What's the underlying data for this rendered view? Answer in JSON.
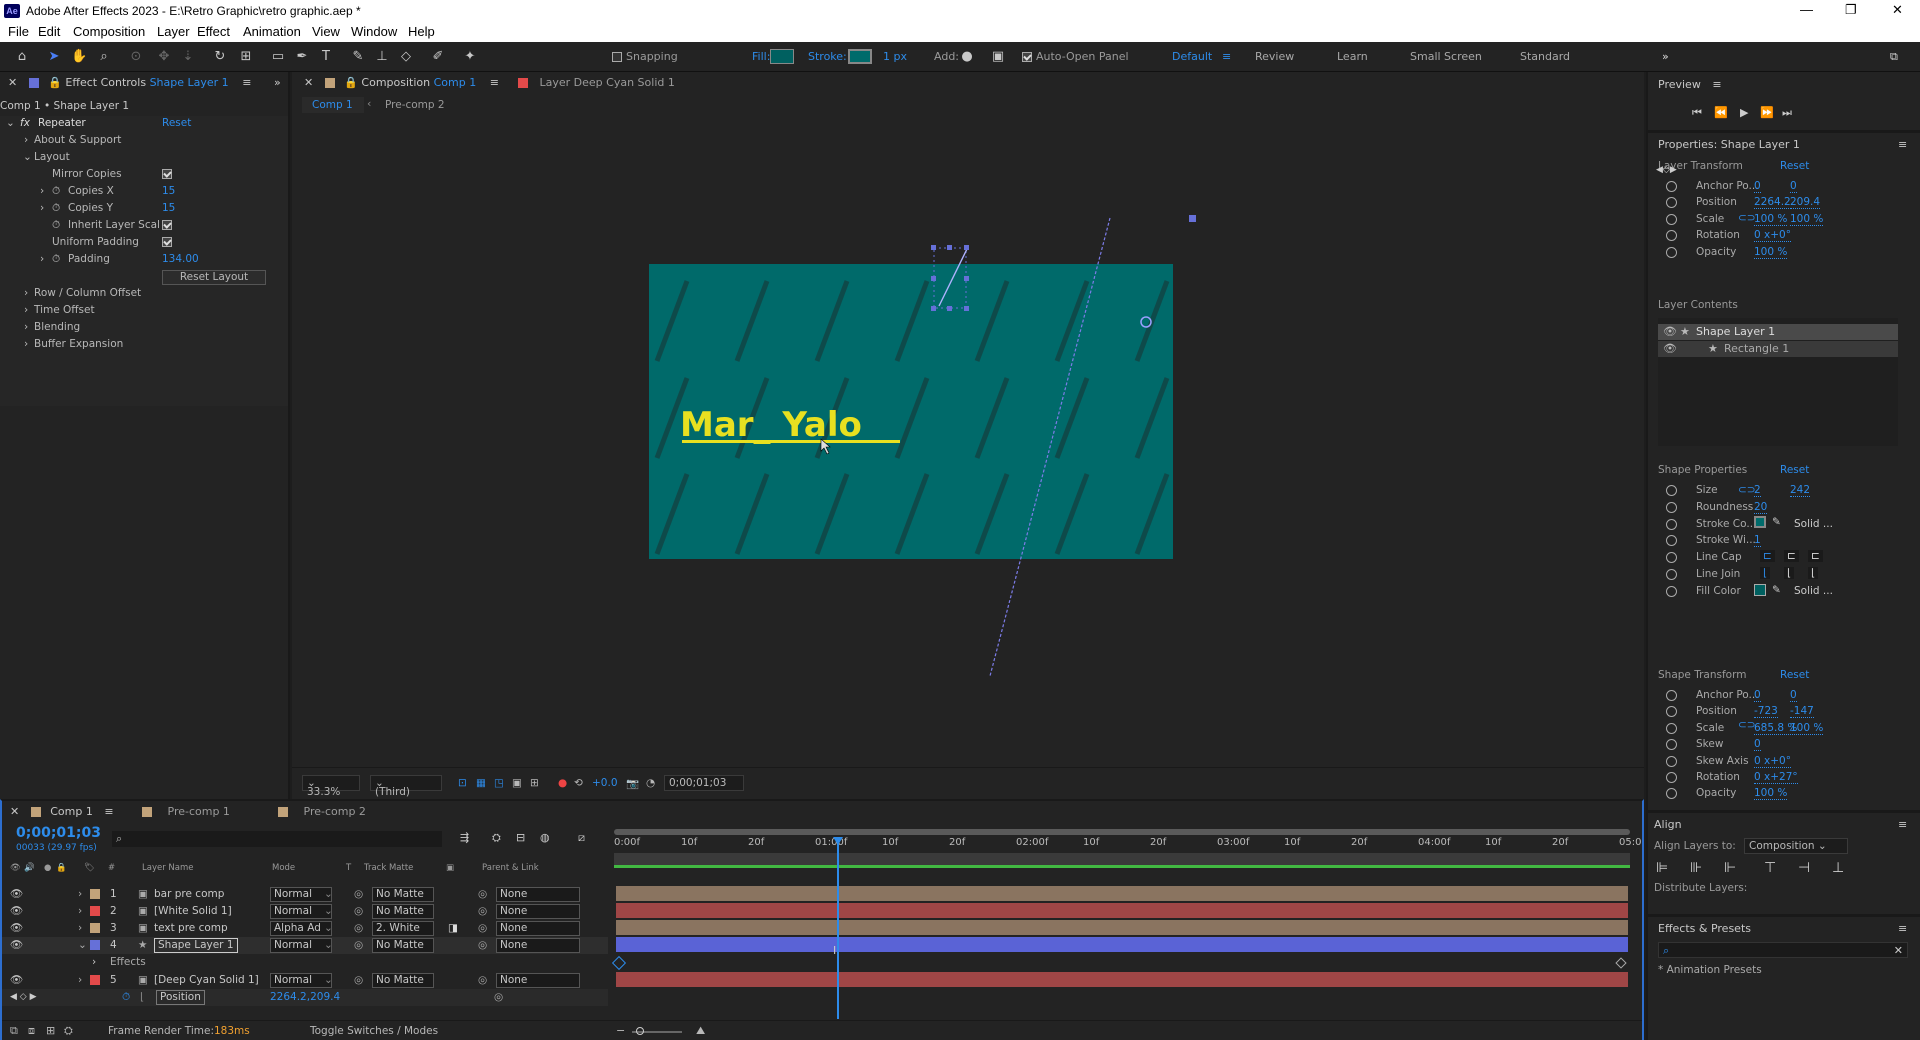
{
  "titlebar": {
    "title": "Adobe After Effects 2023 - E:\\Retro Graphic\\retro graphic.aep *",
    "minimize": "—",
    "maximize": "❐",
    "close": "✕",
    "logo": "Ae"
  },
  "menu": [
    "File",
    "Edit",
    "Composition",
    "Layer",
    "Effect",
    "Animation",
    "View",
    "Window",
    "Help"
  ],
  "toolbar": {
    "snapping": "Snapping",
    "fill_label": "Fill:",
    "stroke_label": "Stroke:",
    "stroke_width": "1 px",
    "add_label": "Add:",
    "auto_open": "Auto-Open Panel",
    "workspaces": [
      "Default",
      "Review",
      "Learn",
      "Small Screen",
      "Standard"
    ],
    "fill_color": "#006060",
    "stroke_color": "#006b6b"
  },
  "effect_controls": {
    "tab_label": "Effect Controls",
    "tab_layer": "Shape Layer 1",
    "breadcrumb": "Comp 1 • Shape Layer 1",
    "effect_name": "Repeater",
    "reset": "Reset",
    "about": "About & Support",
    "layout": "Layout",
    "mirror": "Mirror Copies",
    "copies_x": "Copies X",
    "copies_x_val": "15",
    "copies_y": "Copies Y",
    "copies_y_val": "15",
    "inherit": "Inherit Layer Scal",
    "uniform": "Uniform Padding",
    "padding": "Padding",
    "padding_val": "134.00",
    "reset_layout": "Reset Layout",
    "row_col": "Row / Column Offset",
    "time_offset": "Time Offset",
    "blending": "Blending",
    "buffer": "Buffer Expansion"
  },
  "composition": {
    "tab_label": "Composition",
    "tab_comp": "Comp 1",
    "layer_tab": "Layer  Deep Cyan Solid 1",
    "sub_tabs": [
      "Comp 1",
      "Pre-comp 2"
    ],
    "canvas_text": "Mar_ Yalo",
    "zoom": "33.3%",
    "resolution": "(Third)",
    "exposure": "+0.0",
    "timecode": "0;00;01;03",
    "bg_color": "#006a6a",
    "stripe_color": "#0e4a4a",
    "text_color": "#e8e020"
  },
  "preview": {
    "label": "Preview"
  },
  "properties": {
    "title": "Properties: Shape Layer 1",
    "layer_transform": "Layer Transform",
    "reset": "Reset",
    "rows": [
      {
        "name": "Anchor Po...",
        "v1": "0",
        "v2": "0"
      },
      {
        "name": "Position",
        "v1": "2264.2",
        "v2": "209.4"
      },
      {
        "name": "Scale",
        "v1": "100 %",
        "v2": "100 %"
      },
      {
        "name": "Rotation",
        "v1": "0 x+0°",
        "v2": ""
      },
      {
        "name": "Opacity",
        "v1": "100 %",
        "v2": ""
      }
    ],
    "layer_contents": "Layer Contents",
    "contents": [
      "Shape Layer 1",
      "Rectangle 1"
    ],
    "shape_properties": "Shape Properties",
    "shape_rows": [
      {
        "name": "Size",
        "v1": "2",
        "v2": "242"
      },
      {
        "name": "Roundness",
        "v1": "20",
        "v2": ""
      },
      {
        "name": "Stroke Co...",
        "v1": "",
        "v2": "Solid ..."
      },
      {
        "name": "Stroke Wi...",
        "v1": "1",
        "v2": ""
      },
      {
        "name": "Line Cap",
        "v1": "",
        "v2": ""
      },
      {
        "name": "Line Join",
        "v1": "",
        "v2": ""
      },
      {
        "name": "Fill Color",
        "v1": "",
        "v2": "Solid ..."
      }
    ],
    "shape_transform": "Shape Transform",
    "st_rows": [
      {
        "name": "Anchor Po...",
        "v1": "0",
        "v2": "0"
      },
      {
        "name": "Position",
        "v1": "-723",
        "v2": "-147"
      },
      {
        "name": "Scale",
        "v1": "685.8 %",
        "v2": "100 %"
      },
      {
        "name": "Skew",
        "v1": "0",
        "v2": ""
      },
      {
        "name": "Skew Axis",
        "v1": "0 x+0°",
        "v2": ""
      },
      {
        "name": "Rotation",
        "v1": "0 x+27°",
        "v2": ""
      },
      {
        "name": "Opacity",
        "v1": "100 %",
        "v2": ""
      }
    ],
    "align": "Align",
    "align_to_label": "Align Layers to:",
    "align_to": "Composition",
    "distribute": "Distribute Layers:",
    "effects_presets": "Effects & Presets",
    "animation_presets": "* Animation Presets"
  },
  "timeline": {
    "tabs": [
      "Comp 1",
      "Pre-comp 1",
      "Pre-comp 2"
    ],
    "timecode": "0;00;01;03",
    "fps": "00033 (29.97 fps)",
    "headers": {
      "num": "#",
      "name": "Layer Name",
      "mode": "Mode",
      "t": "T",
      "matte": "Track Matte",
      "parent": "Parent & Link"
    },
    "ruler": [
      "0:00f",
      "10f",
      "20f",
      "01:00f",
      "10f",
      "20f",
      "02:00f",
      "10f",
      "20f",
      "03:00f",
      "10f",
      "20f",
      "04:00f",
      "10f",
      "20f",
      "05:0"
    ],
    "layers": [
      {
        "num": "1",
        "name": "bar pre comp",
        "mode": "Normal",
        "matte": "No Matte",
        "parent": "None",
        "color": "#c2a37a"
      },
      {
        "num": "2",
        "name": "[White Solid 1]",
        "mode": "Normal",
        "matte": "No Matte",
        "parent": "None",
        "color": "#e34a4a"
      },
      {
        "num": "3",
        "name": "text pre comp",
        "mode": "Alpha Ad",
        "matte": "2. White",
        "parent": "None",
        "color": "#c2a37a"
      },
      {
        "num": "4",
        "name": "Shape Layer 1",
        "mode": "Normal",
        "matte": "No Matte",
        "parent": "None",
        "color": "#6670d8"
      },
      {
        "num": "5",
        "name": "[Deep Cyan Solid 1]",
        "mode": "Normal",
        "matte": "No Matte",
        "parent": "None",
        "color": "#e34a4a"
      }
    ],
    "effects_label": "Effects",
    "position_label": "Position",
    "position_value": "2264.2,209.4",
    "frame_render_label": "Frame Render Time:",
    "frame_render_value": "183ms",
    "toggle": "Toggle Switches / Modes"
  }
}
